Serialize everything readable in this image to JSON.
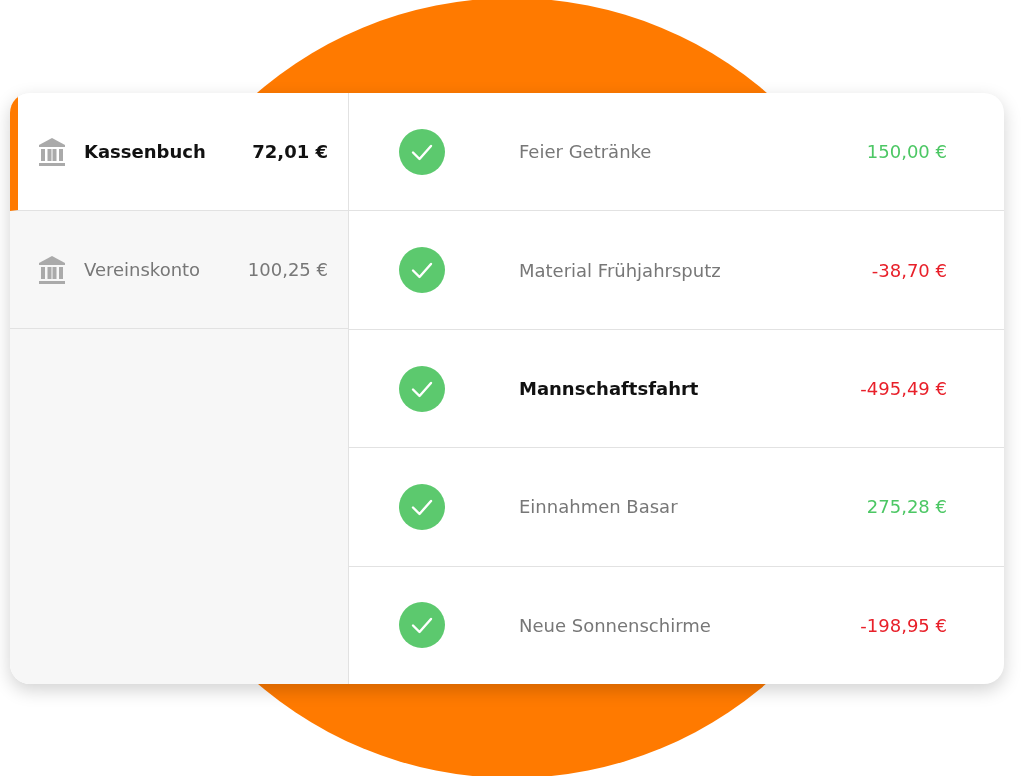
{
  "accounts": [
    {
      "name": "Kassenbuch",
      "balance": "72,01 €",
      "selected": true
    },
    {
      "name": "Vereinskonto",
      "balance": "100,25 €",
      "selected": false
    }
  ],
  "transactions": [
    {
      "title": "Feier Getränke",
      "amount": "150,00 €",
      "kind": "income",
      "checked": true,
      "selected": false
    },
    {
      "title": "Material Frühjahrsputz",
      "amount": "-38,70 €",
      "kind": "expense",
      "checked": true,
      "selected": false
    },
    {
      "title": "Mannschaftsfahrt",
      "amount": "-495,49 €",
      "kind": "expense",
      "checked": true,
      "selected": true
    },
    {
      "title": "Einnahmen Basar",
      "amount": "275,28 €",
      "kind": "income",
      "checked": true,
      "selected": false
    },
    {
      "title": "Neue Sonnenschirme",
      "amount": "-198,95 €",
      "kind": "expense",
      "checked": true,
      "selected": false
    }
  ]
}
